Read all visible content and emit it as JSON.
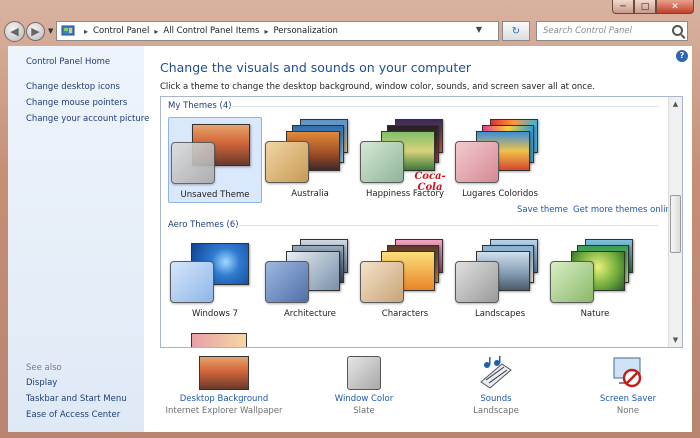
{
  "window": {
    "caption_buttons": [
      "minimize-icon",
      "maximize-icon",
      "close-icon"
    ]
  },
  "address_bar": {
    "crumbs": [
      "Control Panel",
      "All Control Panel Items",
      "Personalization"
    ],
    "search_placeholder": "Search Control Panel"
  },
  "sidebar": {
    "home": "Control Panel Home",
    "links": [
      "Change desktop icons",
      "Change mouse pointers",
      "Change your account picture"
    ],
    "see_also_label": "See also",
    "see_also": [
      "Display",
      "Taskbar and Start Menu",
      "Ease of Access Center"
    ]
  },
  "main": {
    "heading": "Change the visuals and sounds on your computer",
    "subtext": "Click a theme to change the desktop background, window color, sounds, and screen saver all at once.",
    "my_themes_title": "My Themes (4)",
    "my_themes": [
      {
        "label": "Unsaved Theme",
        "selected": true
      },
      {
        "label": "Australia",
        "selected": false
      },
      {
        "label": "Happiness Factory",
        "selected": false
      },
      {
        "label": "Lugares Coloridos",
        "selected": false
      }
    ],
    "coca_cola_logo": "Coca-Cola",
    "save_theme": "Save theme",
    "get_more": "Get more themes online",
    "aero_themes_title": "Aero Themes (6)",
    "aero_themes": [
      {
        "label": "Windows 7"
      },
      {
        "label": "Architecture"
      },
      {
        "label": "Characters"
      },
      {
        "label": "Landscapes"
      },
      {
        "label": "Nature"
      }
    ]
  },
  "bottom": [
    {
      "title": "Desktop Background",
      "sub": "Internet Explorer Wallpaper"
    },
    {
      "title": "Window Color",
      "sub": "Slate"
    },
    {
      "title": "Sounds",
      "sub": "Landscape"
    },
    {
      "title": "Screen Saver",
      "sub": "None"
    }
  ],
  "colors": {
    "link": "#1e56b0",
    "heading": "#1f4e94",
    "selection": "#d9e8fb"
  }
}
